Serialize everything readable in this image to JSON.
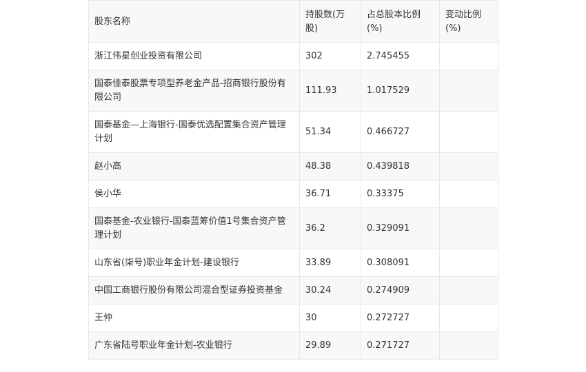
{
  "table": {
    "headers": [
      "股东名称",
      "持股数(万股)",
      "占总股本比例(%)",
      "变动比例(%)"
    ],
    "rows": [
      [
        "浙江伟星创业投资有限公司",
        "302",
        "2.745455",
        ""
      ],
      [
        "国泰佳泰股票专项型养老金产品-招商银行股份有限公司",
        "111.93",
        "1.017529",
        ""
      ],
      [
        "国泰基金—上海银行-国泰优选配置集合资产管理计划",
        "51.34",
        "0.466727",
        ""
      ],
      [
        "赵小高",
        "48.38",
        "0.439818",
        ""
      ],
      [
        "侯小华",
        "36.71",
        "0.33375",
        ""
      ],
      [
        "国泰基金-农业银行-国泰蓝筹价值1号集合资产管理计划",
        "36.2",
        "0.329091",
        ""
      ],
      [
        "山东省(柒号)职业年金计划-建设银行",
        "33.89",
        "0.308091",
        ""
      ],
      [
        "中国工商银行股份有限公司混合型证券投资基金",
        "30.24",
        "0.274909",
        ""
      ],
      [
        "王仲",
        "30",
        "0.272727",
        ""
      ],
      [
        "广东省陆号职业年金计划-农业银行",
        "29.89",
        "0.271727",
        ""
      ]
    ]
  }
}
